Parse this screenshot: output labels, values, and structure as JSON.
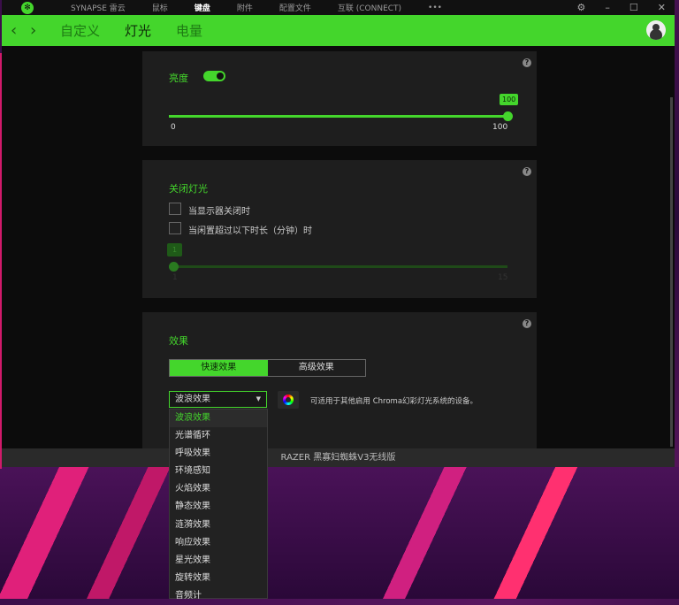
{
  "titlebar": {
    "nav": [
      "SYNAPSE 雷云",
      "鼠标",
      "键盘",
      "附件",
      "配置文件",
      "互联 (CONNECT)",
      "•••"
    ],
    "active": 2
  },
  "subnav": {
    "tabs": [
      "自定义",
      "灯光",
      "电量"
    ],
    "active": 1
  },
  "brightness": {
    "label": "亮度",
    "enabled": true,
    "value": 100,
    "value_label": "100",
    "min_label": "0",
    "max_label": "100"
  },
  "lights_off": {
    "title": "关闭灯光",
    "options": [
      {
        "label": "当显示器关闭时",
        "checked": false
      },
      {
        "label": "当闲置超过以下时长（分钟）时",
        "checked": false
      }
    ],
    "value_label": "1",
    "min_label": "1",
    "max_label": "15"
  },
  "effects": {
    "title": "效果",
    "tabs": [
      "快速效果",
      "高级效果"
    ],
    "active_tab": 0,
    "selected": "波浪效果",
    "note": "可适用于其他启用 Chroma幻彩灯光系统的设备。",
    "options": [
      "波浪效果",
      "光谱循环",
      "呼吸效果",
      "环境感知",
      "火焰效果",
      "静态效果",
      "涟漪效果",
      "响应效果",
      "星光效果",
      "旋转效果",
      "音频计"
    ]
  },
  "footer": {
    "device": "RAZER 黑寡妇蜘蛛V3无线版"
  },
  "colors": {
    "accent": "#44d62c"
  }
}
